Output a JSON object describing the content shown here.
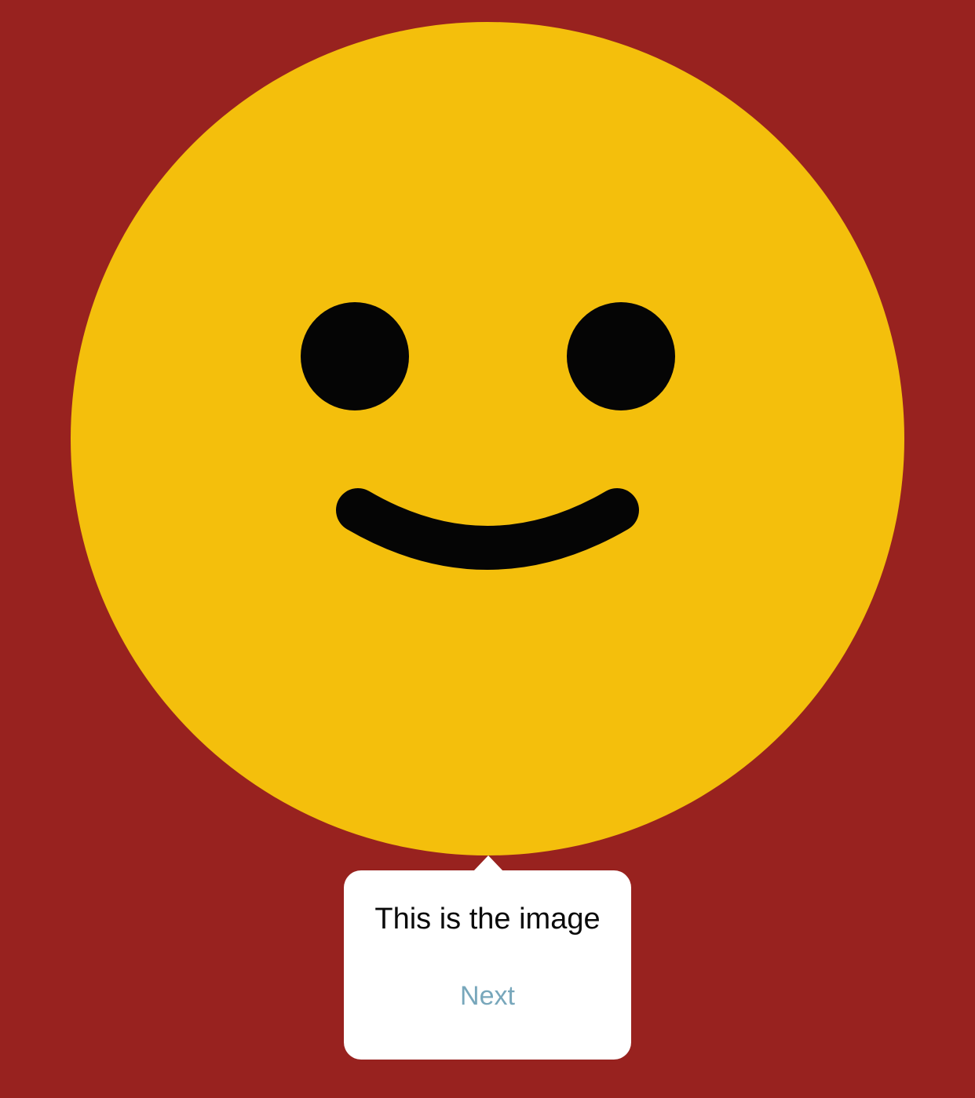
{
  "image": {
    "icon": "smiley-face-icon",
    "face_color": "#f4bf0c",
    "feature_color": "#050505"
  },
  "background_color": "#98221f",
  "tooltip": {
    "text": "This is the image",
    "next_label": "Next",
    "next_color": "#78a7bb"
  }
}
